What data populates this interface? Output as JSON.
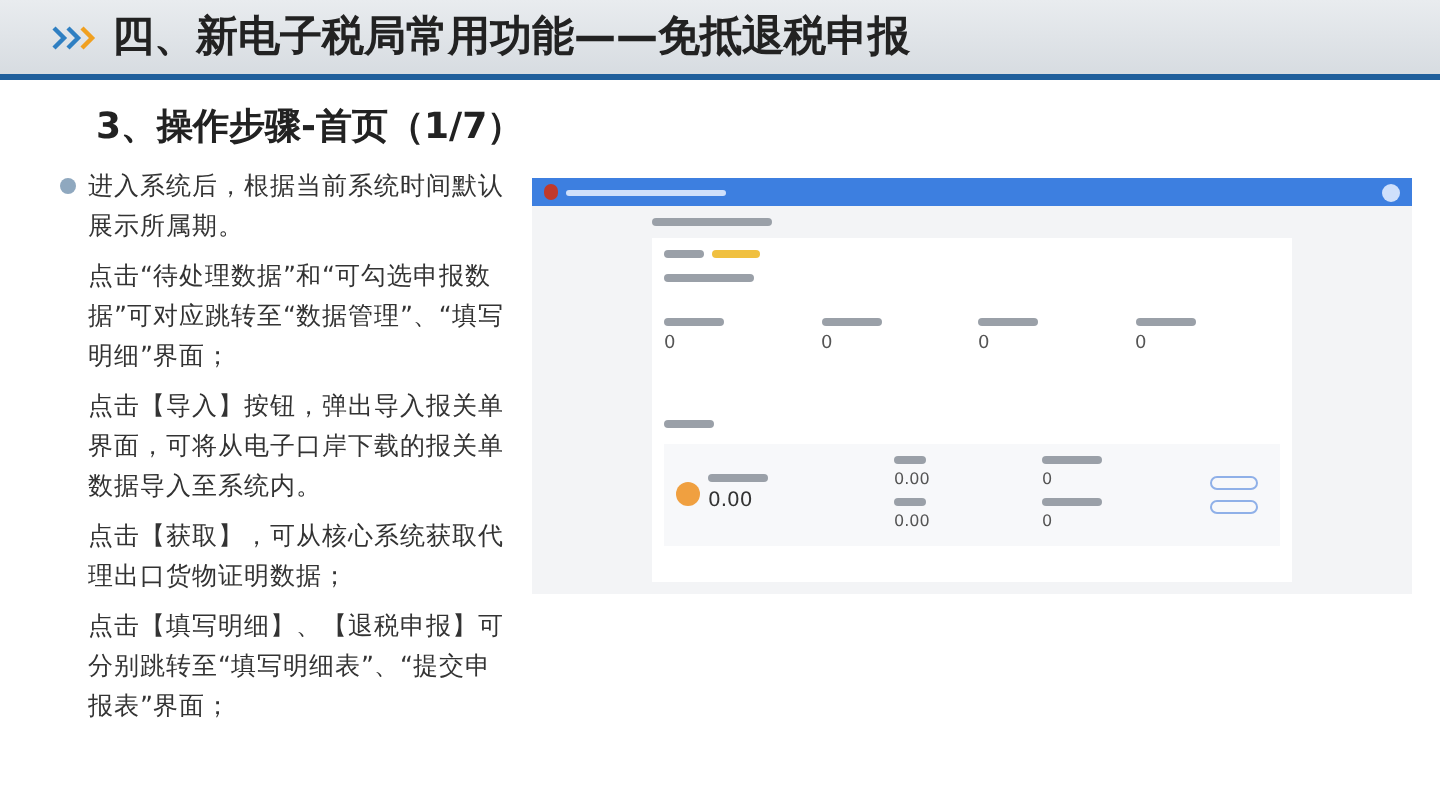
{
  "header": {
    "title": "四、新电子税局常用功能——免抵退税申报"
  },
  "subtitle": "3、操作步骤-首页（1/7）",
  "paragraphs": [
    {
      "text": "进入系统后，根据当前系统时间默认展示所属期。",
      "bullet": true
    },
    {
      "text": "点击“待处理数据”和“可勾选申报数据”可对应跳转至“数据管理”、“填写明细”界面；",
      "bullet": false
    },
    {
      "text": "点击【导入】按钮，弹出导入报关单界面，可将从电子口岸下载的报关单数据导入至系统内。",
      "bullet": false
    },
    {
      "text": "点击【获取】，可从核心系统获取代理出口货物证明数据；",
      "bullet": false
    },
    {
      "text": "点击【填写明细】、【退税申报】可分别跳转至“填写明细表”、“提交申报表”界面；",
      "bullet": false
    }
  ],
  "screenshot": {
    "counts": [
      "0",
      "0",
      "0",
      "0"
    ],
    "total": "0.00",
    "amounts": [
      "0.00",
      "0.00"
    ],
    "counts_2": [
      "0",
      "0"
    ]
  }
}
